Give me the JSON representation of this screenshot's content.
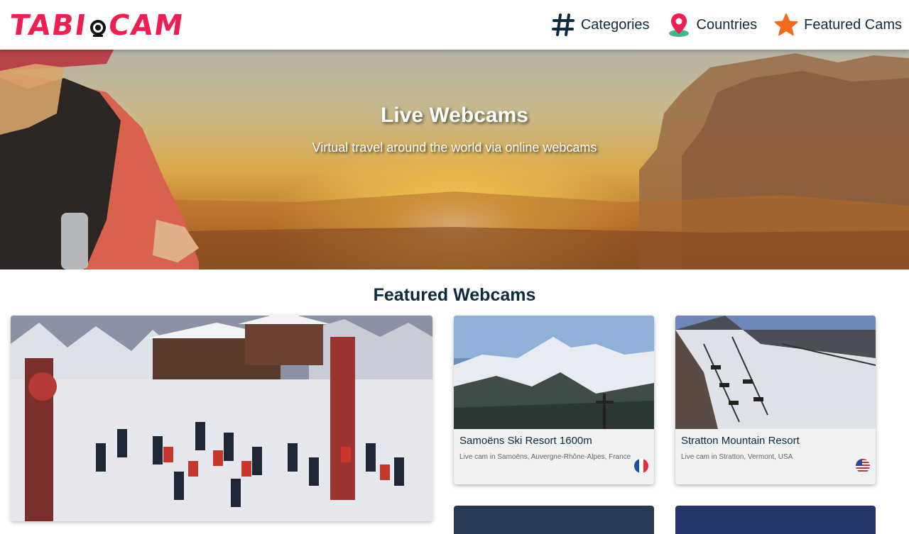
{
  "header": {
    "logo_text_left": "TABI",
    "logo_text_right": "CAM",
    "nav": [
      {
        "label": "Categories",
        "icon": "hash-icon"
      },
      {
        "label": "Countries",
        "icon": "map-pin-icon"
      },
      {
        "label": "Featured Cams",
        "icon": "star-icon"
      }
    ]
  },
  "hero": {
    "title": "Live Webcams",
    "subtitle": "Virtual travel around the world via online webcams"
  },
  "featured": {
    "title": "Featured Webcams",
    "cards": [
      {
        "title": "Samoëns Ski Resort 1600m",
        "subtitle": "Live cam in Samoëns, Auvergne-Rhône-Alpes, France",
        "flag": "france-flag-icon"
      },
      {
        "title": "Stratton Mountain Resort",
        "subtitle": "Live cam in Stratton, Vermont, USA",
        "flag": "usa-flag-icon"
      }
    ]
  },
  "colors": {
    "brand": "#ee1d52",
    "text_dark": "#0d2b3e",
    "star": "#f26a1b"
  }
}
